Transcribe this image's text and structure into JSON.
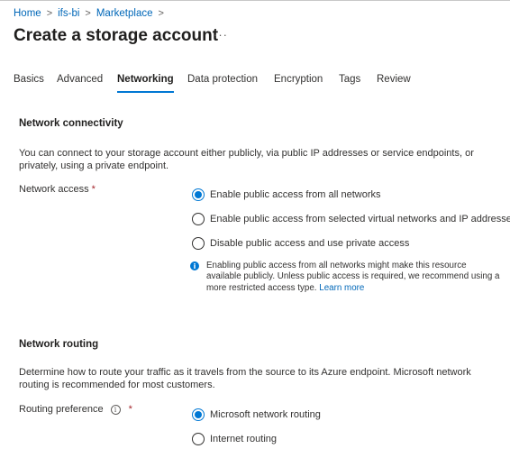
{
  "breadcrumb": {
    "items": [
      "Home",
      "ifs-bi",
      "Marketplace"
    ],
    "separator": ">"
  },
  "page": {
    "title": "Create a storage account",
    "more_label": "···"
  },
  "tabs": [
    {
      "label": "Basics",
      "active": false
    },
    {
      "label": "Advanced",
      "active": false
    },
    {
      "label": "Networking",
      "active": true
    },
    {
      "label": "Data protection",
      "active": false
    },
    {
      "label": "Encryption",
      "active": false
    },
    {
      "label": "Tags",
      "active": false
    },
    {
      "label": "Review",
      "active": false
    }
  ],
  "network_connectivity": {
    "title": "Network connectivity",
    "description": "You can connect to your storage account either publicly, via public IP addresses or service endpoints, or privately, using a private endpoint.",
    "field_label": "Network access",
    "required_mark": "*",
    "options": [
      {
        "label": "Enable public access from all networks",
        "checked": true
      },
      {
        "label": "Enable public access from selected virtual networks and IP addresses",
        "checked": false
      },
      {
        "label": "Disable public access and use private access",
        "checked": false
      }
    ],
    "info_icon": "i",
    "info_text": "Enabling public access from all networks might make this resource available publicly. Unless public access is required, we recommend using a more restricted access type.",
    "info_link": "Learn more"
  },
  "network_routing": {
    "title": "Network routing",
    "description": "Determine how to route your traffic as it travels from the source to its Azure endpoint. Microsoft network routing is recommended for most customers.",
    "field_label": "Routing preference",
    "info_icon": "i",
    "required_mark": "*",
    "options": [
      {
        "label": "Microsoft network routing",
        "checked": true
      },
      {
        "label": "Internet routing",
        "checked": false
      }
    ]
  },
  "colors": {
    "accent": "#0078d4",
    "link": "#0067b8",
    "required": "#a4262c"
  }
}
